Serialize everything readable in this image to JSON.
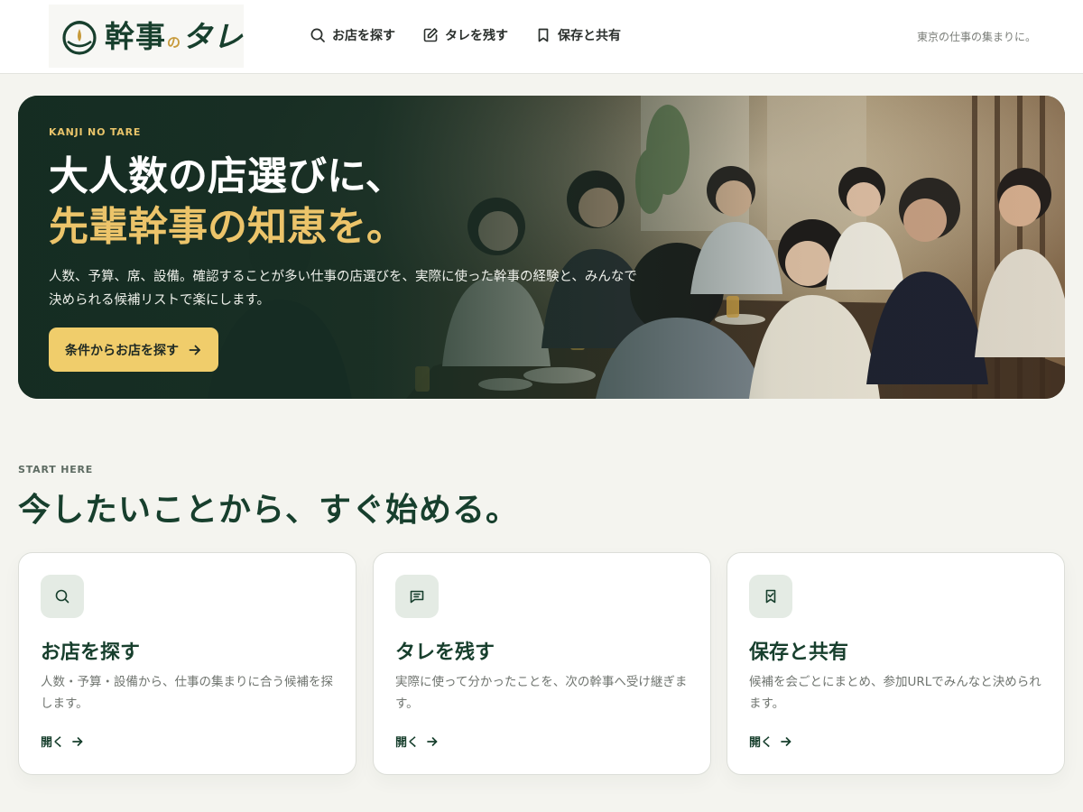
{
  "colors": {
    "brand_green": "#173f2d",
    "accent_gold": "#ecc46a",
    "cta_gold": "#f0cd6b",
    "page_bg": "#f4f4ef"
  },
  "header": {
    "logo": {
      "main": "幹事",
      "no": "の",
      "tare": "タレ"
    },
    "nav": [
      {
        "label": "お店を探す",
        "icon": "search-icon"
      },
      {
        "label": "タレを残す",
        "icon": "edit-icon"
      },
      {
        "label": "保存と共有",
        "icon": "bookmark-icon"
      }
    ],
    "tagline": "東京の仕事の集まりに。"
  },
  "hero": {
    "eyebrow": "KANJI NO TARE",
    "title_line1": "大人数の店選びに、",
    "title_line2": "先輩幹事の知恵を。",
    "description": "人数、予算、席、設備。確認することが多い仕事の店選びを、実際に使った幹事の経験と、みんなで決められる候補リストで楽にします。",
    "cta": {
      "label": "条件からお店を探す",
      "icon": "arrow-right-icon"
    }
  },
  "start": {
    "eyebrow": "START HERE",
    "title": "今したいことから、すぐ始める。",
    "cards": [
      {
        "icon": "search-icon",
        "title": "お店を探す",
        "description": "人数・予算・設備から、仕事の集まりに合う候補を探します。",
        "link": "開く"
      },
      {
        "icon": "message-icon",
        "title": "タレを残す",
        "description": "実際に使って分かったことを、次の幹事へ受け継ぎます。",
        "link": "開く"
      },
      {
        "icon": "bookmark-check-icon",
        "title": "保存と共有",
        "description": "候補を会ごとにまとめ、参加URLでみんなと決められます。",
        "link": "開く"
      }
    ]
  }
}
